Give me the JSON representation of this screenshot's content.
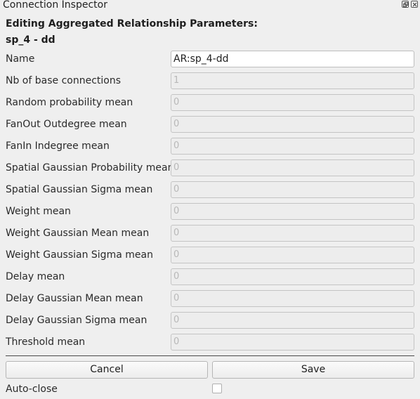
{
  "window": {
    "title": "Connection Inspector"
  },
  "heading": {
    "line1": "Editing Aggregated Relationship Parameters:",
    "line2": "sp_4 - dd"
  },
  "fields": [
    {
      "label": "Name",
      "value": "AR:sp_4-dd",
      "editable": true
    },
    {
      "label": "Nb of base connections",
      "value": "1",
      "editable": false
    },
    {
      "label": "Random probability mean",
      "value": "0",
      "editable": false
    },
    {
      "label": "FanOut Outdegree mean",
      "value": "0",
      "editable": false
    },
    {
      "label": "FanIn Indegree mean",
      "value": "0",
      "editable": false
    },
    {
      "label": "Spatial Gaussian Probability mean",
      "value": "0",
      "editable": false
    },
    {
      "label": "Spatial Gaussian Sigma mean",
      "value": "0",
      "editable": false
    },
    {
      "label": "Weight mean",
      "value": "0",
      "editable": false
    },
    {
      "label": "Weight Gaussian Mean mean",
      "value": "0",
      "editable": false
    },
    {
      "label": "Weight Gaussian Sigma mean",
      "value": "0",
      "editable": false
    },
    {
      "label": "Delay mean",
      "value": "0",
      "editable": false
    },
    {
      "label": "Delay Gaussian Mean mean",
      "value": "0",
      "editable": false
    },
    {
      "label": "Delay Gaussian Sigma mean",
      "value": "0",
      "editable": false
    },
    {
      "label": "Threshold mean",
      "value": "0",
      "editable": false
    }
  ],
  "buttons": {
    "cancel": "Cancel",
    "save": "Save"
  },
  "auto_close": {
    "label": "Auto-close",
    "checked": false
  },
  "icons": {
    "float": "float-window-icon",
    "close": "close-window-icon"
  }
}
